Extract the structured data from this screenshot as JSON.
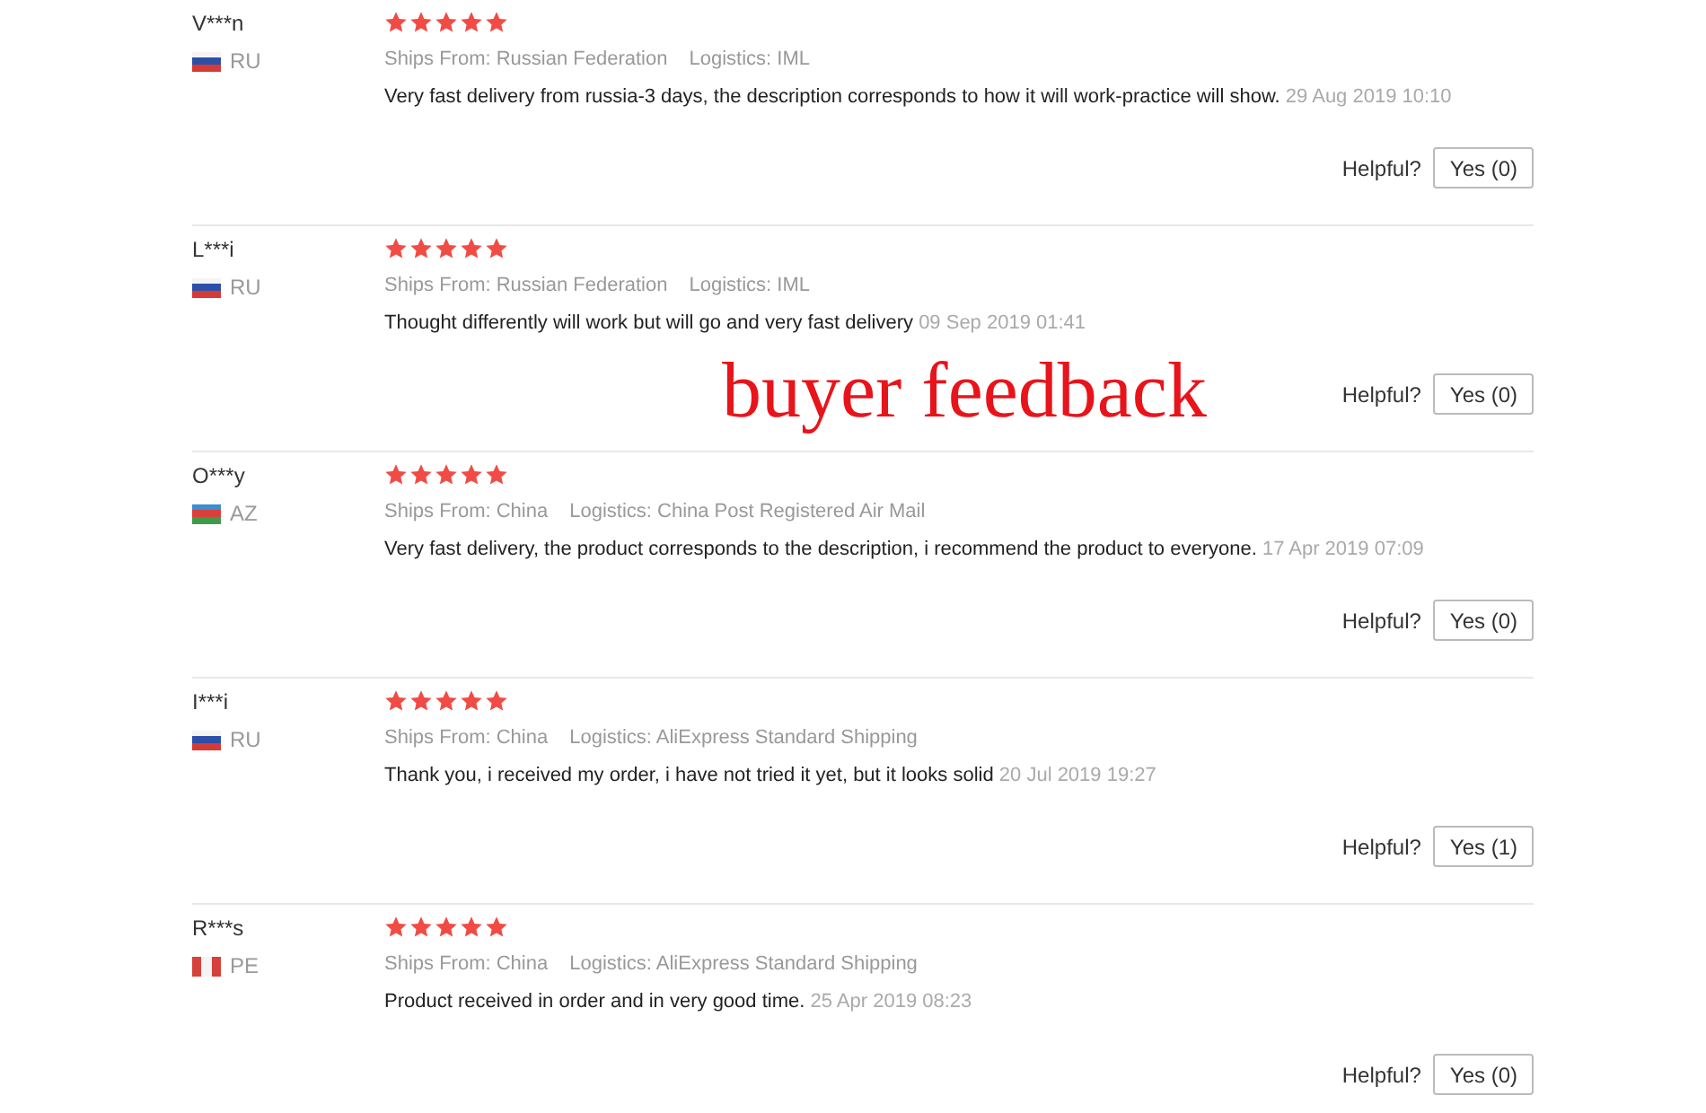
{
  "reviews": [
    {
      "name": "V***n",
      "country": "RU",
      "flag": {
        "kind": "ru"
      },
      "stars": 5,
      "ships_from": "Ships From: Russian Federation",
      "logistics": "Logistics: IML",
      "text": "Very fast delivery from russia-3 days, the description corresponds to how it will work-practice will show.",
      "date": "29 Aug 2019 10:10",
      "helpful_label": "Helpful?",
      "yes_button": "Yes (0)"
    },
    {
      "name": "L***i",
      "country": "RU",
      "flag": {
        "kind": "ru"
      },
      "stars": 5,
      "ships_from": "Ships From: Russian Federation",
      "logistics": "Logistics: IML",
      "text": "Thought differently will work but will go and very fast delivery",
      "date": "09 Sep 2019 01:41",
      "helpful_label": "Helpful?",
      "yes_button": "Yes (0)"
    },
    {
      "name": "O***y",
      "country": "AZ",
      "flag": {
        "kind": "az"
      },
      "stars": 5,
      "ships_from": "Ships From: China",
      "logistics": "Logistics: China Post Registered Air Mail",
      "text": "Very fast delivery, the product corresponds to the description, i recommend the product to everyone.",
      "date": "17 Apr 2019 07:09",
      "helpful_label": "Helpful?",
      "yes_button": "Yes (0)"
    },
    {
      "name": "I***i",
      "country": "RU",
      "flag": {
        "kind": "ru"
      },
      "stars": 5,
      "ships_from": "Ships From: China",
      "logistics": "Logistics: AliExpress Standard Shipping",
      "text": "Thank you, i received my order, i have not tried it yet, but it looks solid",
      "date": "20 Jul 2019 19:27",
      "helpful_label": "Helpful?",
      "yes_button": "Yes (1)"
    },
    {
      "name": "R***s",
      "country": "PE",
      "flag": {
        "kind": "pe"
      },
      "stars": 5,
      "ships_from": "Ships From: China",
      "logistics": "Logistics: AliExpress Standard Shipping",
      "text": "Product received in order and in very good time.",
      "date": "25 Apr 2019 08:23",
      "helpful_label": "Helpful?",
      "yes_button": "Yes (0)"
    }
  ],
  "overlay_caption": "buyer feedback"
}
